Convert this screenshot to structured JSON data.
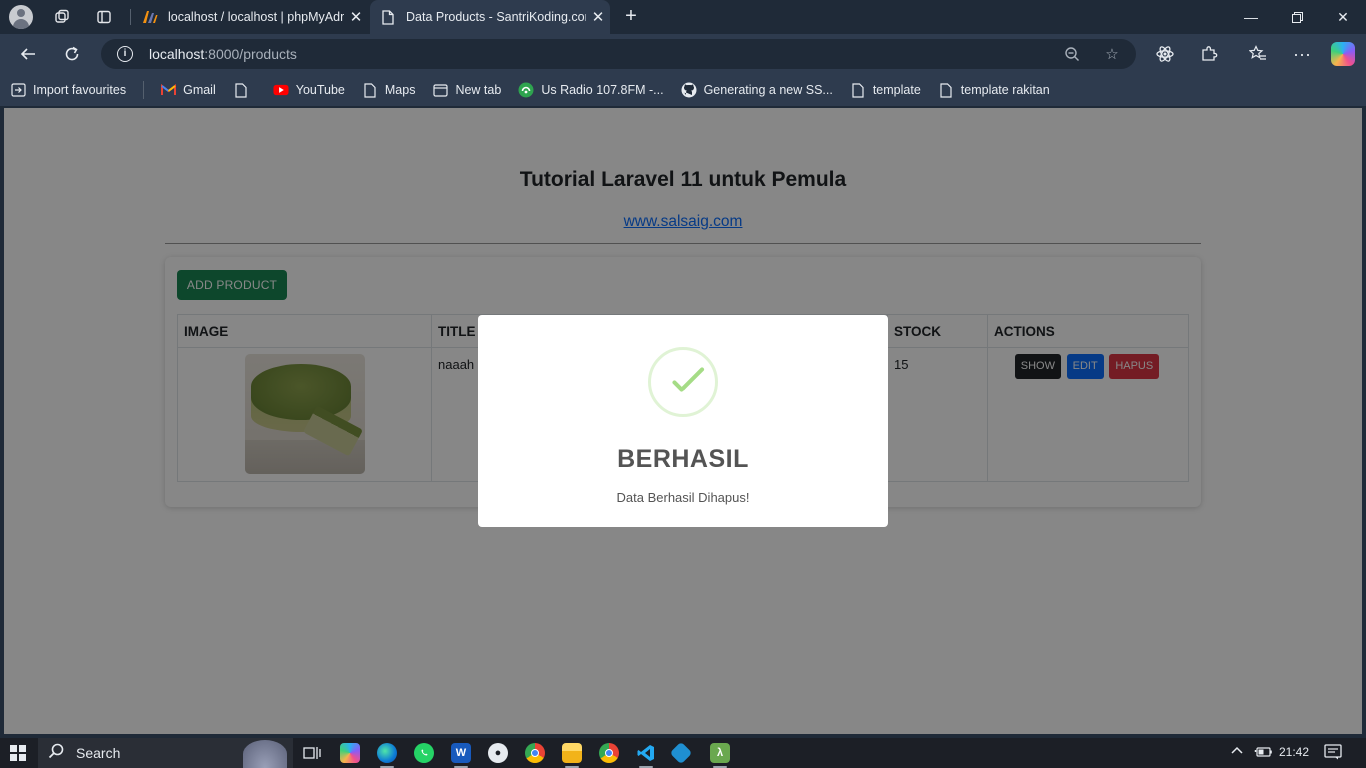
{
  "browser": {
    "tabs": [
      {
        "title": "localhost / localhost | phpMyAdm",
        "active": false
      },
      {
        "title": "Data Products - SantriKoding.com",
        "active": true
      }
    ],
    "url_host": "localhost",
    "url_path": ":8000/products",
    "bookmarks": [
      {
        "label": "Import favourites",
        "icon": "import-icon"
      },
      {
        "label": "Gmail",
        "icon": "gmail-icon"
      },
      {
        "label": "",
        "icon": "page-icon"
      },
      {
        "label": "YouTube",
        "icon": "youtube-icon"
      },
      {
        "label": "Maps",
        "icon": "page-icon"
      },
      {
        "label": "New tab",
        "icon": "newtab-icon"
      },
      {
        "label": "Us Radio 107.8FM -...",
        "icon": "radio-icon"
      },
      {
        "label": "Generating a new SS...",
        "icon": "github-icon"
      },
      {
        "label": "template",
        "icon": "page-icon"
      },
      {
        "label": "template rakitan",
        "icon": "page-icon"
      }
    ]
  },
  "page": {
    "title": "Tutorial Laravel 11 untuk Pemula",
    "link": "www.salsaig.com",
    "add_button": "ADD PRODUCT",
    "table": {
      "headers": [
        "IMAGE",
        "TITLE",
        "STOCK",
        "ACTIONS"
      ],
      "rows": [
        {
          "title": "naaah",
          "stock": "15"
        }
      ],
      "actions": {
        "show": "SHOW",
        "edit": "EDIT",
        "delete": "HAPUS"
      }
    }
  },
  "modal": {
    "title": "BERHASIL",
    "message": "Data Berhasil Dihapus!"
  },
  "taskbar": {
    "search_label": "Search",
    "time": "21:42"
  },
  "colors": {
    "success_green": "#198754",
    "primary_blue": "#0d6efd",
    "danger_red": "#dc3545",
    "check_green": "#a5dc86"
  }
}
